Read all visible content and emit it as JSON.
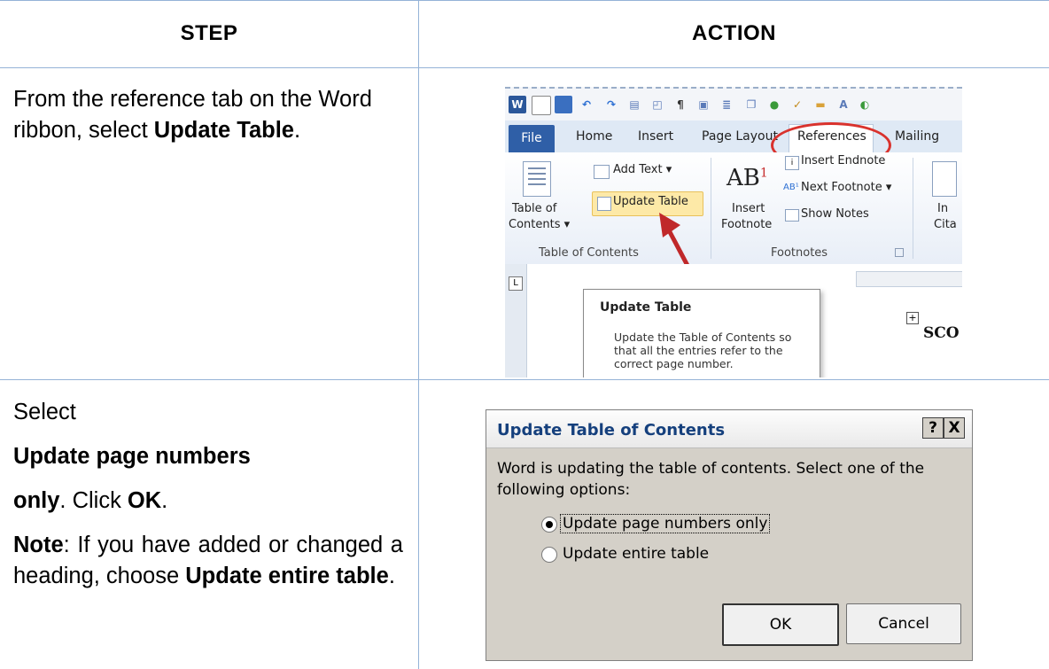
{
  "table": {
    "header_step": "STEP",
    "header_action": "ACTION"
  },
  "row1": {
    "text": "From the reference tab on the Word ribbon, select",
    "bold": "Update Table",
    "end": "."
  },
  "row2": {
    "select": "Select",
    "bold_line1": "Update page numbers",
    "bold_line2": "only",
    "click": ". Click ",
    "ok": "OK",
    "ok_end": ".",
    "note_label": "Note",
    "note_text": ":  If you have added or changed a heading, choose ",
    "note_bold": "Update entire table",
    "note_end": "."
  },
  "ribbon": {
    "tabs": [
      "File",
      "Home",
      "Insert",
      "Page Layout",
      "References",
      "Mailing"
    ],
    "add_text": "Add Text",
    "update_table": "Update Table",
    "table_of": "Table of",
    "contents": "Contents",
    "group_toc": "Table of Contents",
    "insert_endnote": "Insert Endnote",
    "next_footnote": "Next Footnote",
    "insert": "Insert",
    "footnote": "Footnote",
    "show_notes": "Show Notes",
    "ab": "AB",
    "group_footnotes": "Footnotes",
    "in_cut": "In",
    "cita_cut": "Cita",
    "ruler_corner": "L",
    "tooltip_title": "Update Table",
    "tooltip_body": "Update the Table of Contents so that all the entries refer to the correct page number.",
    "doc_text": "SCO"
  },
  "dialog": {
    "title": "Update Table of Contents",
    "help": "?",
    "close": "X",
    "message": "Word is updating the table of contents.  Select one of the following options:",
    "option1": "Update page numbers only",
    "option2": "Update entire table",
    "ok": "OK",
    "cancel": "Cancel"
  },
  "colors": {
    "table_border": "#95b3d7",
    "highlight_ring": "#d9322d",
    "file_tab": "#2f5fa7"
  }
}
